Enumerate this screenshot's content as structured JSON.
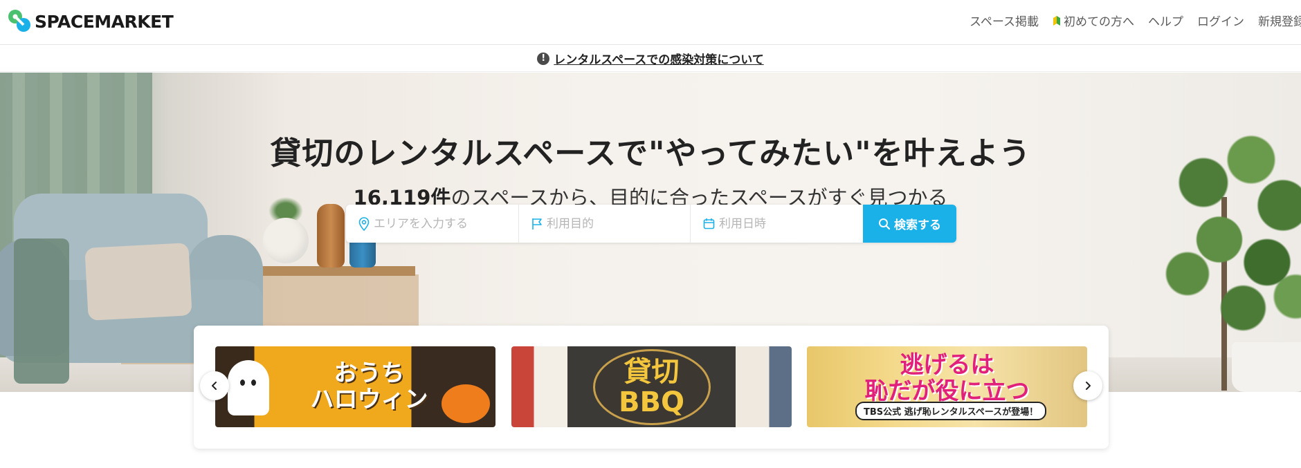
{
  "header": {
    "logo_text": "SPACEMARKET",
    "nav": [
      {
        "label": "スペース掲載"
      },
      {
        "label": "初めての方へ"
      },
      {
        "label": "ヘルプ"
      },
      {
        "label": "ログイン"
      },
      {
        "label": "新規登録"
      }
    ]
  },
  "notice": {
    "icon": "!",
    "link_text": "レンタルスペースでの感染対策について"
  },
  "hero": {
    "title": "貸切のレンタルスペースで\"やってみたい\"を叶えよう",
    "count": "16,119件",
    "subtitle_rest": "のスペースから、目的に合ったスペースがすぐ見つかる"
  },
  "search": {
    "area_placeholder": "エリアを入力する",
    "purpose_placeholder": "利用目的",
    "date_placeholder": "利用日時",
    "button_label": "検索する"
  },
  "banners": [
    {
      "title_line1": "おうち",
      "title_line2": "ハロウィン"
    },
    {
      "title_line1": "貸切",
      "title_line2": "BBQ"
    },
    {
      "title_line1": "逃げるは",
      "title_line2": "恥だが役に立つ",
      "tag": "TBS公式 逃げ恥レンタルスペースが登場！"
    }
  ],
  "colors": {
    "accent": "#1ab0e8",
    "logo_green": "#4bc16f",
    "logo_blue": "#1ab0e8"
  }
}
